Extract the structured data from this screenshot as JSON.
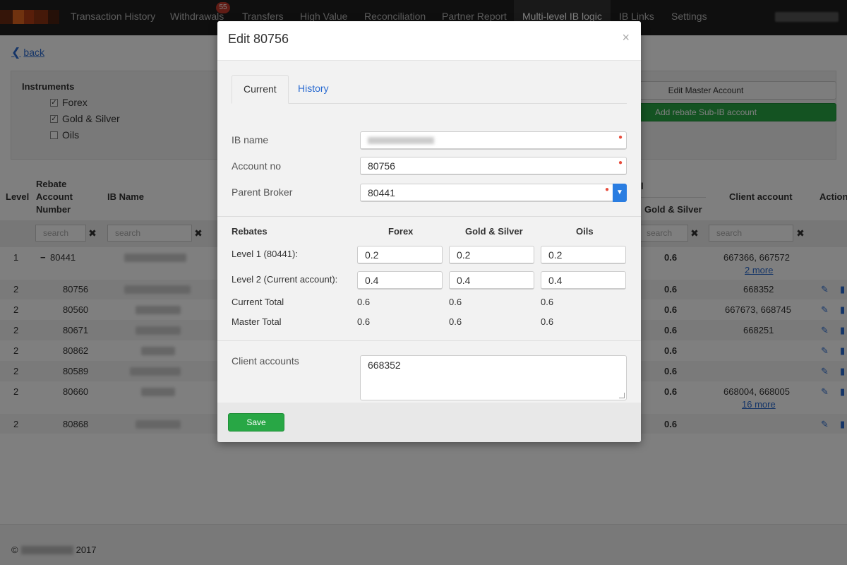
{
  "nav": {
    "items": [
      "Transaction History",
      "Withdrawals",
      "Transfers",
      "High Value",
      "Reconciliation",
      "Partner Report",
      "Multi-level IB logic",
      "IB Links",
      "Settings"
    ],
    "withdrawals_badge": "55",
    "active_index": 6
  },
  "back_label": "back",
  "instruments": {
    "title": "Instruments",
    "options": [
      {
        "label": "Forex",
        "checked": true
      },
      {
        "label": "Gold & Silver",
        "checked": true
      },
      {
        "label": "Oils",
        "checked": false
      }
    ],
    "edit_master_label": "Edit Master Account",
    "add_sub_label": "Add rebate Sub-IB account"
  },
  "table": {
    "headers": {
      "level": "Level",
      "rebate_account_number": "Rebate Account Number",
      "ib_name": "IB Name",
      "group_suffix": "l",
      "gold_silver": "Gold & Silver",
      "client_account": "Client account",
      "actions": "Actions"
    },
    "search_placeholder": "search",
    "rows": [
      {
        "level": "1",
        "account": "80441",
        "value": "0.6",
        "clients": "667366, 667572",
        "more": "2 more"
      },
      {
        "level": "2",
        "account": "80756",
        "value": "0.6",
        "clients": "668352",
        "more": ""
      },
      {
        "level": "2",
        "account": "80560",
        "value": "0.6",
        "clients": "667673, 668745",
        "more": ""
      },
      {
        "level": "2",
        "account": "80671",
        "value": "0.6",
        "clients": "668251",
        "more": ""
      },
      {
        "level": "2",
        "account": "80862",
        "value": "0.6",
        "clients": "",
        "more": ""
      },
      {
        "level": "2",
        "account": "80589",
        "value": "0.6",
        "clients": "",
        "more": ""
      },
      {
        "level": "2",
        "account": "80660",
        "value": "0.6",
        "clients": "668004, 668005",
        "more": "16 more"
      },
      {
        "level": "2",
        "account": "80868",
        "value": "0.6",
        "clients": "",
        "more": ""
      }
    ]
  },
  "footer": {
    "copyright_symbol": "©",
    "year": "2017"
  },
  "modal": {
    "title": "Edit 80756",
    "close": "×",
    "tabs": {
      "current": "Current",
      "history": "History"
    },
    "fields": {
      "ib_name_label": "IB name",
      "account_no_label": "Account no",
      "account_no_value": "80756",
      "parent_broker_label": "Parent Broker",
      "parent_broker_value": "80441"
    },
    "rebates": {
      "header": "Rebates",
      "columns": [
        "Forex",
        "Gold & Silver",
        "Oils"
      ],
      "level1_label": "Level 1 (80441):",
      "level1_values": [
        "0.2",
        "0.2",
        "0.2"
      ],
      "level2_label": "Level 2 (Current account):",
      "level2_values": [
        "0.4",
        "0.4",
        "0.4"
      ],
      "current_total_label": "Current Total",
      "current_total_values": [
        "0.6",
        "0.6",
        "0.6"
      ],
      "master_total_label": "Master Total",
      "master_total_values": [
        "0.6",
        "0.6",
        "0.6"
      ]
    },
    "client_accounts_label": "Client accounts",
    "client_accounts_value": "668352",
    "save_label": "Save"
  },
  "colors": {
    "accent_blue": "#2a6bd1",
    "save_green": "#28a745",
    "nav_bg": "#1f1f1f",
    "required": "#e74c3c"
  }
}
